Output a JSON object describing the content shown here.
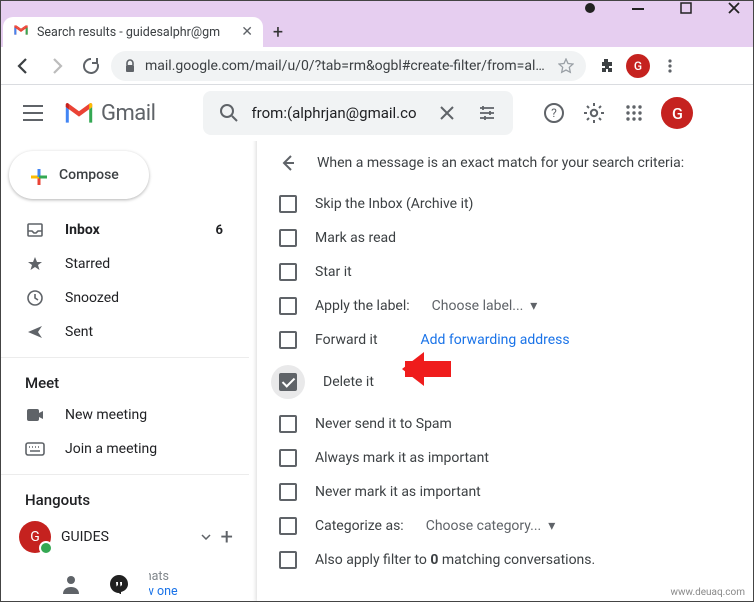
{
  "browser": {
    "tab_title": "Search results - guidesalphr@gm",
    "url": "mail.google.com/mail/u/0/?tab=rm&ogbl#create-filter/from=alphrja...",
    "profile_letter": "G"
  },
  "header": {
    "logo_text": "Gmail",
    "search_value": "from:(alphrjan@gmail.co",
    "account_letter": "G"
  },
  "sidebar": {
    "compose": "Compose",
    "items": [
      {
        "label": "Inbox",
        "count": "6",
        "bold": true
      },
      {
        "label": "Starred"
      },
      {
        "label": "Snoozed"
      },
      {
        "label": "Sent"
      }
    ],
    "meet_heading": "Meet",
    "meet_items": [
      {
        "label": "New meeting"
      },
      {
        "label": "Join a meeting"
      }
    ],
    "hangouts_heading": "Hangouts",
    "hangouts_name": "GUIDES",
    "hangouts_avatar": "G",
    "no_chats": "No recent chats",
    "start_new": "Start a new one"
  },
  "filter": {
    "heading": "When a message is an exact match for your search criteria:",
    "options": [
      {
        "label": "Skip the Inbox (Archive it)",
        "checked": false
      },
      {
        "label": "Mark as read",
        "checked": false
      },
      {
        "label": "Star it",
        "checked": false
      },
      {
        "label": "Apply the label:",
        "checked": false,
        "extra": "Choose label...",
        "dropdown": true
      },
      {
        "label": "Forward it",
        "checked": false,
        "link": "Add forwarding address"
      },
      {
        "label": "Delete it",
        "checked": true,
        "highlight": true
      },
      {
        "label": "Never send it to Spam",
        "checked": false
      },
      {
        "label": "Always mark it as important",
        "checked": false
      },
      {
        "label": "Never mark it as important",
        "checked": false
      },
      {
        "label": "Categorize as:",
        "checked": false,
        "extra": "Choose category...",
        "dropdown": true
      },
      {
        "label": "Also apply filter to 0 matching conversations.",
        "checked": false,
        "bold_zero": true
      }
    ]
  },
  "watermark": "www.deuaq.com"
}
